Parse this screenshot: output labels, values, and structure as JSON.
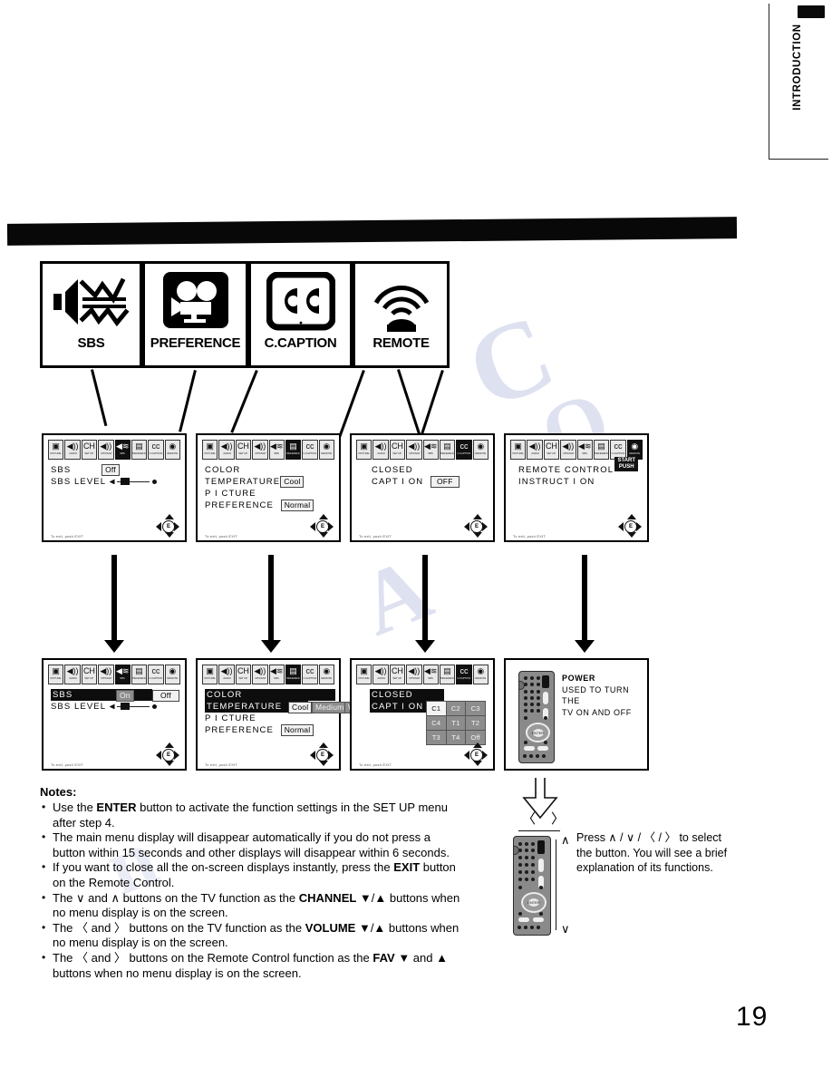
{
  "page": {
    "number": "19",
    "side_tab": "INTRODUCTION"
  },
  "icon_header": [
    {
      "label": "SBS",
      "icon": "speaker-waves-icon"
    },
    {
      "label": "PREFERENCE",
      "icon": "movie-camera-icon"
    },
    {
      "label": "C.CAPTION",
      "icon": "closed-caption-icon"
    },
    {
      "label": "REMOTE",
      "icon": "remote-signal-icon"
    }
  ],
  "menu_icon_bar": [
    {
      "sym": "⬛",
      "label": "PICTURE"
    },
    {
      "sym": "🔊",
      "label": "AUDIO"
    },
    {
      "sym": "CH",
      "label": "SET UP"
    },
    {
      "sym": "🔊",
      "label": "MTS/SAP"
    },
    {
      "sym": "≋",
      "label": "SBS"
    },
    {
      "sym": "⬜",
      "label": "PREFERENCE"
    },
    {
      "sym": "CC",
      "label": "C.CAPTION"
    },
    {
      "sym": "◎",
      "label": "REMOTE"
    }
  ],
  "screens_row1": [
    {
      "id": "sbs",
      "selected_index": 4,
      "lines": [
        {
          "label": "SBS",
          "value": "Off",
          "type": "value"
        },
        {
          "label": "SBS  LEVEL",
          "type": "slider"
        }
      ],
      "exit": "To exit, push EXIT"
    },
    {
      "id": "preference",
      "selected_index": 5,
      "lines": [
        {
          "label": "COLOR",
          "type": "text"
        },
        {
          "label": "  TEMPERATURE",
          "value": "Cool",
          "type": "value"
        },
        {
          "label": "P I CTURE",
          "type": "text"
        },
        {
          "label": "  PREFERENCE",
          "value": "Normal",
          "type": "value"
        }
      ],
      "exit": "To exit, push EXIT"
    },
    {
      "id": "ccaption",
      "selected_index": 6,
      "lines": [
        {
          "label": "CLOSED",
          "type": "text"
        },
        {
          "label": "  CAPT I ON",
          "value": "OFF",
          "type": "value"
        }
      ],
      "exit": "To exit, push EXIT"
    },
    {
      "id": "remote",
      "selected_index": 7,
      "lines": [
        {
          "label": "REMOTE  CONTROL",
          "type": "text"
        },
        {
          "label": "  INSTRUCT I ON",
          "type": "text"
        }
      ],
      "badge_line1": "START",
      "badge_line2": "PUSH",
      "exit": "To exit, push EXIT"
    }
  ],
  "screens_row2": [
    {
      "id": "sbs-selected",
      "selected_index": 4,
      "highlight_label": "SBS",
      "option_selected": "On",
      "option_other": "Off",
      "level_label": "SBS  LEVEL",
      "exit": "To exit, push EXIT"
    },
    {
      "id": "preference-selected",
      "selected_index": 5,
      "hl_line1": "COLOR",
      "hl_line2": "  TEMPERATURE",
      "options": [
        "Cool",
        "Medium",
        "Warm"
      ],
      "line3": "P I CTURE",
      "line4": "  PREFERENCE",
      "line4_value": "Normal",
      "exit": "To exit, push EXIT"
    },
    {
      "id": "ccaption-selected",
      "selected_index": 6,
      "hl_line1": "CLOSED",
      "hl_line2": "  CAPT I ON",
      "grid": [
        [
          "C1",
          "C2",
          "C3"
        ],
        [
          "C4",
          "T1",
          "T2"
        ],
        [
          "T3",
          "T4",
          "Off"
        ]
      ],
      "exit": "To exit, push EXIT"
    },
    {
      "id": "remote-instruction",
      "title": "POWER",
      "line1": "USED TO TURN THE",
      "line2": "TV ON AND OFF"
    }
  ],
  "notes": {
    "heading": "Notes:",
    "items": [
      "Use the ENTER button to activate the function settings in the SET UP menu after step 4.",
      "The main menu display will disappear automatically if you do not press a button within 15 seconds and other displays will disappear within 6 seconds.",
      "If you want to close all the on-screen displays instantly, press the EXIT button on the Remote Control.",
      "The ∨ and ∧ buttons on the TV function as the CHANNEL ▼/▲ buttons when no menu display is on the screen.",
      "The 〈 and 〉 buttons on the TV function as the VOLUME ▼/▲ buttons when no menu display is on the screen.",
      "The 〈 and 〉 buttons on the Remote Control function as the FAV ▼ and ▲ buttons when no menu display is on the screen."
    ]
  },
  "hint": {
    "text": "Press ∧ / ∨ / 〈 / 〉 to select the button. You will see a brief explanation of its functions.",
    "left_mark": "〈",
    "right_mark": "〉",
    "up_mark": "∧",
    "down_mark": "∨"
  }
}
